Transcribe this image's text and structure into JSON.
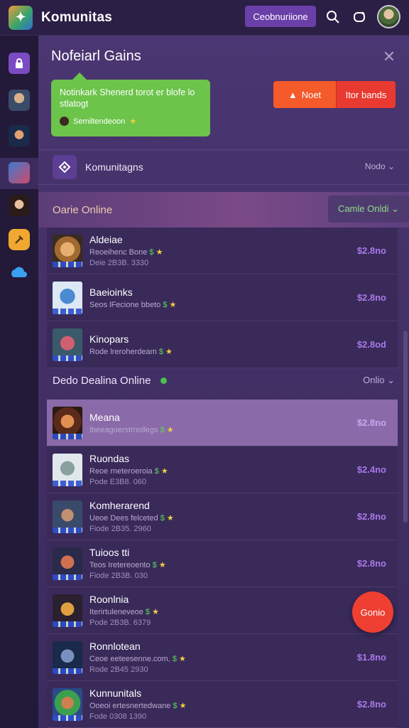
{
  "app": {
    "title": "Komunitas",
    "top_button": "Ceobnuriione"
  },
  "colors": {
    "accent": "#6b3fa8",
    "green": "#6cc44a",
    "orange": "#f45a2a",
    "red": "#e83a30"
  },
  "rail": {
    "icons": [
      "lock-icon",
      "game-avatar-1",
      "game-avatar-2",
      "game-avatar-3",
      "game-avatar-4",
      "pickaxe-icon",
      "cloud-icon"
    ]
  },
  "panel": {
    "title": "Nofeiarl Gains",
    "tooltip": {
      "text": "Notinkark Shenerd torot er blofe lo stlatogt",
      "foot": "Semiltendeoon"
    },
    "action_a": "Noet",
    "action_b": "Itor bands",
    "community": {
      "label": "Komunitagns",
      "right": "Nodo"
    }
  },
  "section1": {
    "title": "Oarie Online",
    "right": "Camle Onldi"
  },
  "section2": {
    "title": "Dedo Dealina  Online",
    "right": "Onlio"
  },
  "list1": [
    {
      "name": "Aldeiae",
      "sub": "Reoeihenc Bone",
      "sub2": "Deie 2B3B. 3330",
      "price": "$2.8no"
    },
    {
      "name": "Baeioinks",
      "sub": "Seos lFecione bbeto",
      "sub2": "",
      "price": "$2.8no"
    },
    {
      "name": "Kinopars",
      "sub": "Rode lreroherdeam",
      "sub2": "",
      "price": "$2.8od"
    }
  ],
  "list2": [
    {
      "name": "Meana",
      "sub": "Ibeeagoerstrnollegs",
      "sub2": "",
      "price": "$2.8no"
    },
    {
      "name": "Ruondas",
      "sub": "Reoe rneteroeroia",
      "sub2": "Pode E3B8. 060",
      "price": "$2.4no"
    },
    {
      "name": "Komherarend",
      "sub": "Ueoe Dees felceted",
      "sub2": "Fiode 2B35. 2960",
      "price": "$2.8no"
    },
    {
      "name": "Tuioos tti",
      "sub": "Teos Iretereoento",
      "sub2": "Fiode 2B3B. 030",
      "price": "$2.8no"
    },
    {
      "name": "Roonlnia",
      "sub": "Iterirtuleneveoe",
      "sub2": "Pode 2B3B. 6379",
      "price": ""
    },
    {
      "name": "Ronnlotean",
      "sub": "Ceoe eeteesenne.com,",
      "sub2": "Rode 2B45 2930",
      "price": "$1.8no"
    },
    {
      "name": "Kunnunitals",
      "sub": "Ooeoi ertesnertedwane",
      "sub2": "Fode 0308 1390",
      "price": "$2.8no"
    }
  ],
  "fab": {
    "label": "Gonio"
  }
}
